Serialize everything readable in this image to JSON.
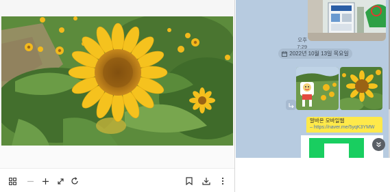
{
  "viewer": {
    "image_alt": "sunflower",
    "toolbar": {
      "grid_icon": "grid-icon",
      "zoom_out_icon": "minus-icon",
      "zoom_in_icon": "plus-icon",
      "fit_icon": "expand-arrows-icon",
      "rotate_icon": "rotate-icon",
      "bookmark_icon": "bookmark-icon",
      "download_icon": "download-icon",
      "more_icon": "more-vertical-icon"
    }
  },
  "chat": {
    "top_message_time": "오후 7:29",
    "date_divider": "2022년 10월 13일 목요일",
    "link_card": {
      "title": "말바온 모바일웹",
      "url": "– https://naver.me/5yqK3YMW"
    },
    "share_icon": "share-icon",
    "scroll_down_icon": "chevron-double-down-icon"
  },
  "colors": {
    "chat_bg": "#b7cbe0",
    "link_card_bg": "#ffe94a",
    "naver_green": "#19ce60"
  }
}
